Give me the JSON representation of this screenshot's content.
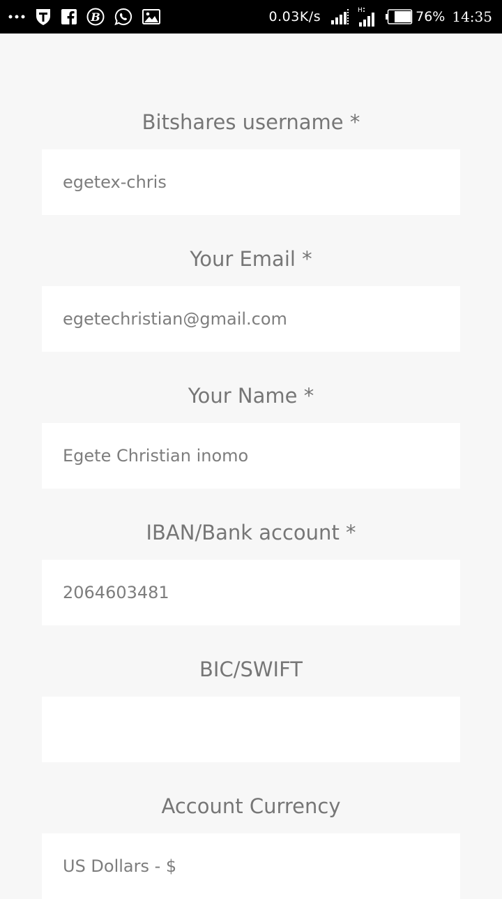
{
  "status_bar": {
    "network_speed": "0.03K/s",
    "network_type": "H",
    "battery_percent": "76%",
    "battery_level": 0.76,
    "time": "14:35",
    "icons": [
      "more-dots-icon",
      "shield-app-icon",
      "facebook-icon",
      "bitcoin-app-icon",
      "whatsapp-icon",
      "gallery-icon",
      "signal-icon",
      "signal-h-icon",
      "battery-icon"
    ]
  },
  "form": {
    "fields": [
      {
        "label": "Bitshares username *",
        "value": "egetex-chris"
      },
      {
        "label": "Your Email *",
        "value": "egetechristian@gmail.com"
      },
      {
        "label": "Your Name *",
        "value": "Egete Christian inomo"
      },
      {
        "label": "IBAN/Bank account *",
        "value": "2064603481"
      },
      {
        "label": "BIC/SWIFT",
        "value": ""
      },
      {
        "label": "Account Currency",
        "value": "US Dollars - $"
      }
    ]
  }
}
